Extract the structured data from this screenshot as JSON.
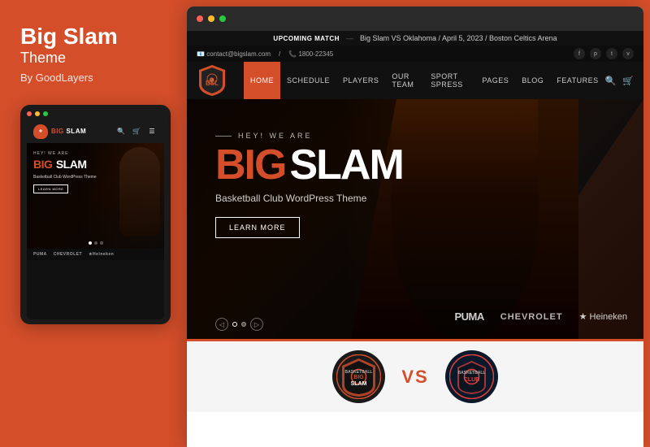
{
  "left": {
    "title": "Big Slam",
    "subtitle": "Theme",
    "by": "By GoodLayers"
  },
  "mobile": {
    "logo_text_orange": "BIG",
    "logo_text_white": "SLAM",
    "hey_label": "HEY! WE ARE",
    "big": "BIG",
    "slam": "SLAM",
    "tagline": "Basketball Club WordPress Theme",
    "cta": "LEARN MORE",
    "sponsors": [
      "PUMA",
      "CHEVROLET",
      "★ Heineken"
    ]
  },
  "browser": {
    "dots": [
      "red",
      "yellow",
      "green"
    ]
  },
  "site": {
    "topbar_label": "UPCOMING MATCH",
    "topbar_sep": "—",
    "topbar_info": "Big Slam VS Oklahoma / April 5, 2023 / Boston Celtics Arena",
    "email": "contact@bigslam.com",
    "phone": "1800-22345",
    "nav_items": [
      "HOME",
      "SCHEDULE",
      "PLAYERS",
      "OUR TEAM",
      "SPORT SPRESS",
      "PAGES",
      "BLOG",
      "FEATURES"
    ],
    "active_nav": "HOME",
    "hey_label": "HEY! WE ARE",
    "hero_big": "BIG",
    "hero_slam": "SLAM",
    "hero_desc": "Basketball Club WordPress Theme",
    "hero_cta": "LEARN MORE",
    "sponsors": {
      "puma": "PUMA",
      "chevrolet": "CHEVROLET",
      "heineken": "★ Heineken"
    },
    "vs_text": "VS"
  }
}
